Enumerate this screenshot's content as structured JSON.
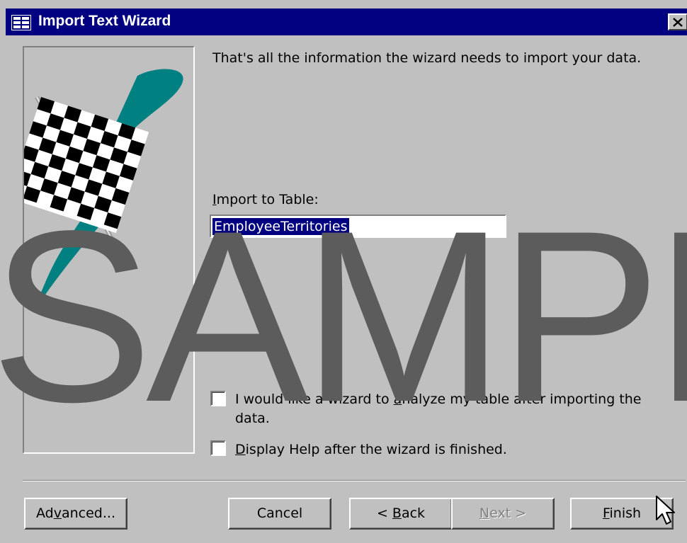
{
  "window": {
    "title": "Import Text Wizard",
    "close_icon": "close-icon"
  },
  "content": {
    "intro": "That's all the information the wizard needs to import your data.",
    "import_label_prefix": "",
    "import_label_u": "I",
    "import_label_rest": "mport to Table:",
    "table_name": "EmployeeTerritories",
    "checkbox_analyze": {
      "line1_a": "I would like a wizard to ",
      "line1_u": "a",
      "line1_b": "nalyze my table after importing the",
      "line2": "data.",
      "checked": false
    },
    "checkbox_help": {
      "label_u": "D",
      "label_rest": "isplay Help after the wizard is finished.",
      "checked": false
    }
  },
  "buttons": {
    "advanced": {
      "pre": "Ad",
      "u": "v",
      "post": "anced..."
    },
    "cancel": {
      "label": "Cancel"
    },
    "back": {
      "pre": "< ",
      "u": "B",
      "post": "ack"
    },
    "next": {
      "u": "N",
      "post": "ext >",
      "disabled": true
    },
    "finish": {
      "u": "F",
      "post": "inish"
    }
  },
  "watermark": "SAMPL",
  "colors": {
    "titlebar": "#000080",
    "face": "#c0c0c0",
    "flag_teal": "#008080",
    "watermark": "#5c5c5c"
  }
}
